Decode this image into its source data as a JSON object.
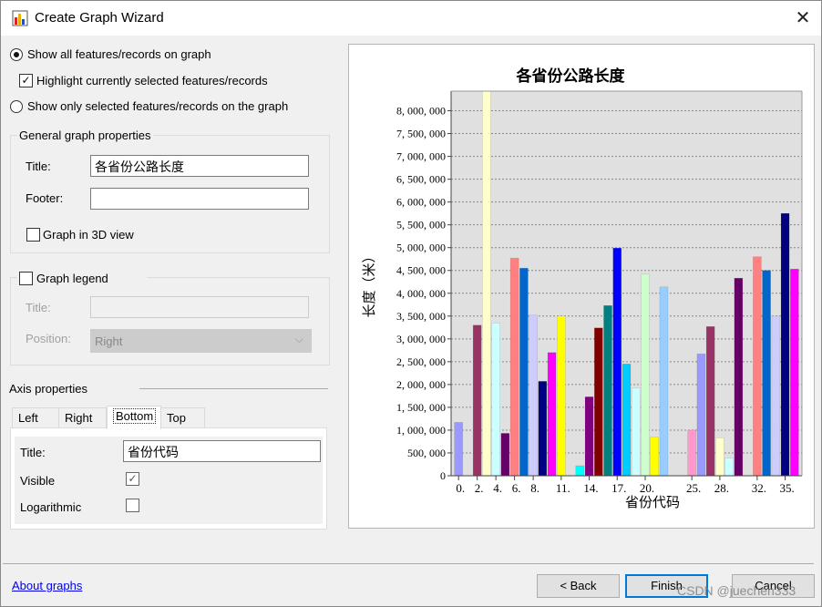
{
  "window": {
    "title": "Create Graph Wizard",
    "close": "✕"
  },
  "options": {
    "show_all": "Show all features/records on graph",
    "highlight": "Highlight currently selected features/records",
    "show_selected": "Show only selected features/records on the graph"
  },
  "general": {
    "legend": "General graph properties",
    "title_label": "Title:",
    "title_value": "各省份公路长度",
    "footer_label": "Footer:",
    "footer_value": "",
    "graph3d": "Graph in 3D view"
  },
  "legend": {
    "label": "Graph legend",
    "title_label": "Title:",
    "title_value": "",
    "position_label": "Position:",
    "position_value": "Right"
  },
  "axis": {
    "label": "Axis properties",
    "tabs": [
      "Left",
      "Right",
      "Bottom",
      "Top"
    ],
    "active_tab": "Bottom",
    "title_label": "Title:",
    "title_value": "省份代码",
    "visible_label": "Visible",
    "visible": true,
    "log_label": "Logarithmic",
    "log": false
  },
  "footer": {
    "about": "About graphs",
    "back": "< Back",
    "finish": "Finish",
    "cancel": "Cancel",
    "watermark": "CSDN @juechen333"
  },
  "chart_data": {
    "type": "bar",
    "title": "各省份公路长度",
    "xlabel": "省份代码",
    "ylabel": "长度（米）",
    "ylim": [
      0,
      8430000
    ],
    "xlim": [
      -0.8,
      36.8
    ],
    "grid": true,
    "legend": "none",
    "yticks": [
      0,
      500000,
      1000000,
      1500000,
      2000000,
      2500000,
      3000000,
      3500000,
      4000000,
      4500000,
      5000000,
      5500000,
      6000000,
      6500000,
      7000000,
      7500000,
      8000000
    ],
    "ytick_labels": [
      "0",
      "500, 000",
      "1, 000, 000",
      "1, 500, 000",
      "2, 000, 000",
      "2, 500, 000",
      "3, 000, 000",
      "3, 500, 000",
      "4, 000, 000",
      "4, 500, 000",
      "5, 000, 000",
      "5, 500, 000",
      "6, 000, 000",
      "6, 500, 000",
      "7, 000, 000",
      "7, 500, 000",
      "8, 000, 000"
    ],
    "xticks": [
      0,
      2,
      4,
      6,
      8,
      11,
      14,
      17,
      20,
      25,
      28,
      32,
      35
    ],
    "xtick_labels": [
      "0.",
      "2.",
      "4.",
      "6.",
      "8.",
      "11.",
      "14.",
      "17.",
      "20.",
      "25.",
      "28.",
      "32.",
      "35."
    ],
    "bars": [
      {
        "x": 0,
        "value": 1170000,
        "color": "#9999ff"
      },
      {
        "x": 2,
        "value": 3300000,
        "color": "#993366"
      },
      {
        "x": 3,
        "value": 8430000,
        "color": "#ffffcc"
      },
      {
        "x": 4,
        "value": 3350000,
        "color": "#ccffff"
      },
      {
        "x": 5,
        "value": 930000,
        "color": "#660066"
      },
      {
        "x": 6,
        "value": 4770000,
        "color": "#ff8080"
      },
      {
        "x": 7,
        "value": 4550000,
        "color": "#0066cc"
      },
      {
        "x": 8,
        "value": 3520000,
        "color": "#ccccff"
      },
      {
        "x": 9,
        "value": 2070000,
        "color": "#000080"
      },
      {
        "x": 10,
        "value": 2700000,
        "color": "#ff00ff"
      },
      {
        "x": 11,
        "value": 3500000,
        "color": "#ffff00"
      },
      {
        "x": 13,
        "value": 220000,
        "color": "#00ffff"
      },
      {
        "x": 14,
        "value": 1730000,
        "color": "#800080"
      },
      {
        "x": 15,
        "value": 3240000,
        "color": "#800000"
      },
      {
        "x": 16,
        "value": 3730000,
        "color": "#008080"
      },
      {
        "x": 17,
        "value": 4990000,
        "color": "#0000ff"
      },
      {
        "x": 18,
        "value": 2450000,
        "color": "#00ccff"
      },
      {
        "x": 19,
        "value": 1920000,
        "color": "#ccffff"
      },
      {
        "x": 20,
        "value": 4420000,
        "color": "#ccffcc"
      },
      {
        "x": 21,
        "value": 850000,
        "color": "#ffff00"
      },
      {
        "x": 22,
        "value": 4140000,
        "color": "#99ccff"
      },
      {
        "x": 25,
        "value": 1000000,
        "color": "#ff99cc"
      },
      {
        "x": 26,
        "value": 2670000,
        "color": "#9999ff"
      },
      {
        "x": 27,
        "value": 3270000,
        "color": "#993366"
      },
      {
        "x": 28,
        "value": 830000,
        "color": "#ffffcc"
      },
      {
        "x": 29,
        "value": 390000,
        "color": "#ccffff"
      },
      {
        "x": 30,
        "value": 4330000,
        "color": "#660066"
      },
      {
        "x": 32,
        "value": 4800000,
        "color": "#ff8080"
      },
      {
        "x": 33,
        "value": 4500000,
        "color": "#0066cc"
      },
      {
        "x": 34,
        "value": 3500000,
        "color": "#ccccff"
      },
      {
        "x": 35,
        "value": 5750000,
        "color": "#000080"
      },
      {
        "x": 36,
        "value": 4530000,
        "color": "#ff00ff"
      }
    ]
  }
}
